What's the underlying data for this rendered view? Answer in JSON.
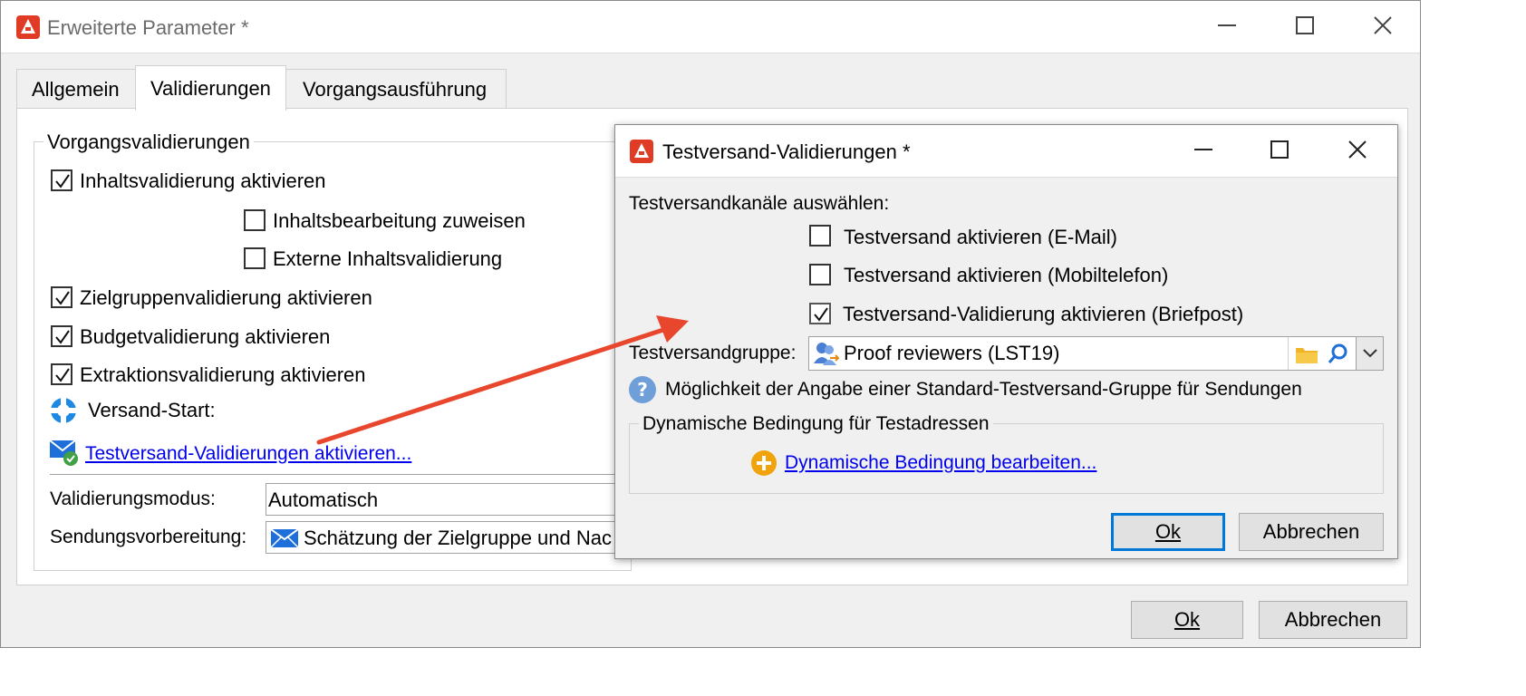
{
  "main_window": {
    "title": "Erweiterte Parameter *",
    "tabs": [
      {
        "label": "Allgemein"
      },
      {
        "label": "Validierungen"
      },
      {
        "label": "Vorgangsausführung"
      }
    ],
    "group_title": "Vorgangsvalidierungen",
    "checks": {
      "content_validation": {
        "label": "Inhaltsvalidierung aktivieren",
        "checked": true
      },
      "assign_content_editing": {
        "label": "Inhaltsbearbeitung zuweisen",
        "checked": false
      },
      "external_content_validation": {
        "label": "Externe Inhaltsvalidierung",
        "checked": false
      },
      "target_validation": {
        "label": "Zielgruppenvalidierung aktivieren",
        "checked": true
      },
      "budget_validation": {
        "label": "Budgetvalidierung aktivieren",
        "checked": true
      },
      "extraction_validation": {
        "label": "Extraktionsvalidierung aktivieren",
        "checked": true
      }
    },
    "delivery_start_label": "Versand-Start:",
    "proof_link": "Testversand-Validierungen aktivieren...",
    "validation_mode_label": "Validierungsmodus:",
    "validation_mode_value": "Automatisch",
    "preparation_label": "Sendungsvorbereitung:",
    "preparation_value": "Schätzung der Zielgruppe und Nac",
    "ok_label": "Ok",
    "cancel_label": "Abbrechen"
  },
  "dialog": {
    "title": "Testversand-Validierungen *",
    "channels_label": "Testversandkanäle auswählen:",
    "checks": {
      "email": {
        "label": "Testversand aktivieren (E-Mail)",
        "checked": false
      },
      "mobile": {
        "label": "Testversand aktivieren (Mobiltelefon)",
        "checked": false
      },
      "mail": {
        "label": "Testversand-Validierung aktivieren (Briefpost)",
        "checked": true
      }
    },
    "group_label": "Testversandgruppe:",
    "group_value": "Proof reviewers (LST19)",
    "help_text": "Möglichkeit der Angabe einer Standard-Testversand-Gruppe für Sendungen",
    "dynamic_group_title": "Dynamische Bedingung für Testadressen",
    "dynamic_link": "Dynamische Bedingung bearbeiten...",
    "ok_label": "Ok",
    "cancel_label": "Abbrechen"
  },
  "colors": {
    "accent": "#0078d7",
    "arrow": "#e8472e",
    "brand": "#e03b24",
    "link": "#0000ee"
  }
}
